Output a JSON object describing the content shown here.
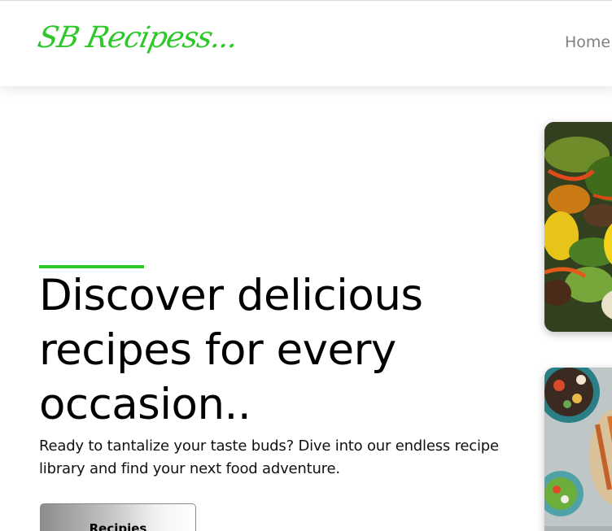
{
  "navbar": {
    "logo_text": "SB Recipess...",
    "links": [
      {
        "label": "Home"
      }
    ]
  },
  "hero": {
    "title": "Discover delicious recipes for every occasion..",
    "subtitle": "Ready to tantalize your taste buds? Dive into our endless recipe library and find your next food adventure.",
    "button_label": "Recipies"
  },
  "images": [
    {
      "subject": "stir-fry vegetables with beef"
    },
    {
      "subject": "bowls of mixed dishes and sweet potato fries"
    }
  ],
  "colors": {
    "brand_green": "#2ec82a",
    "text_dark": "#000000",
    "nav_link_gray": "#808080"
  }
}
